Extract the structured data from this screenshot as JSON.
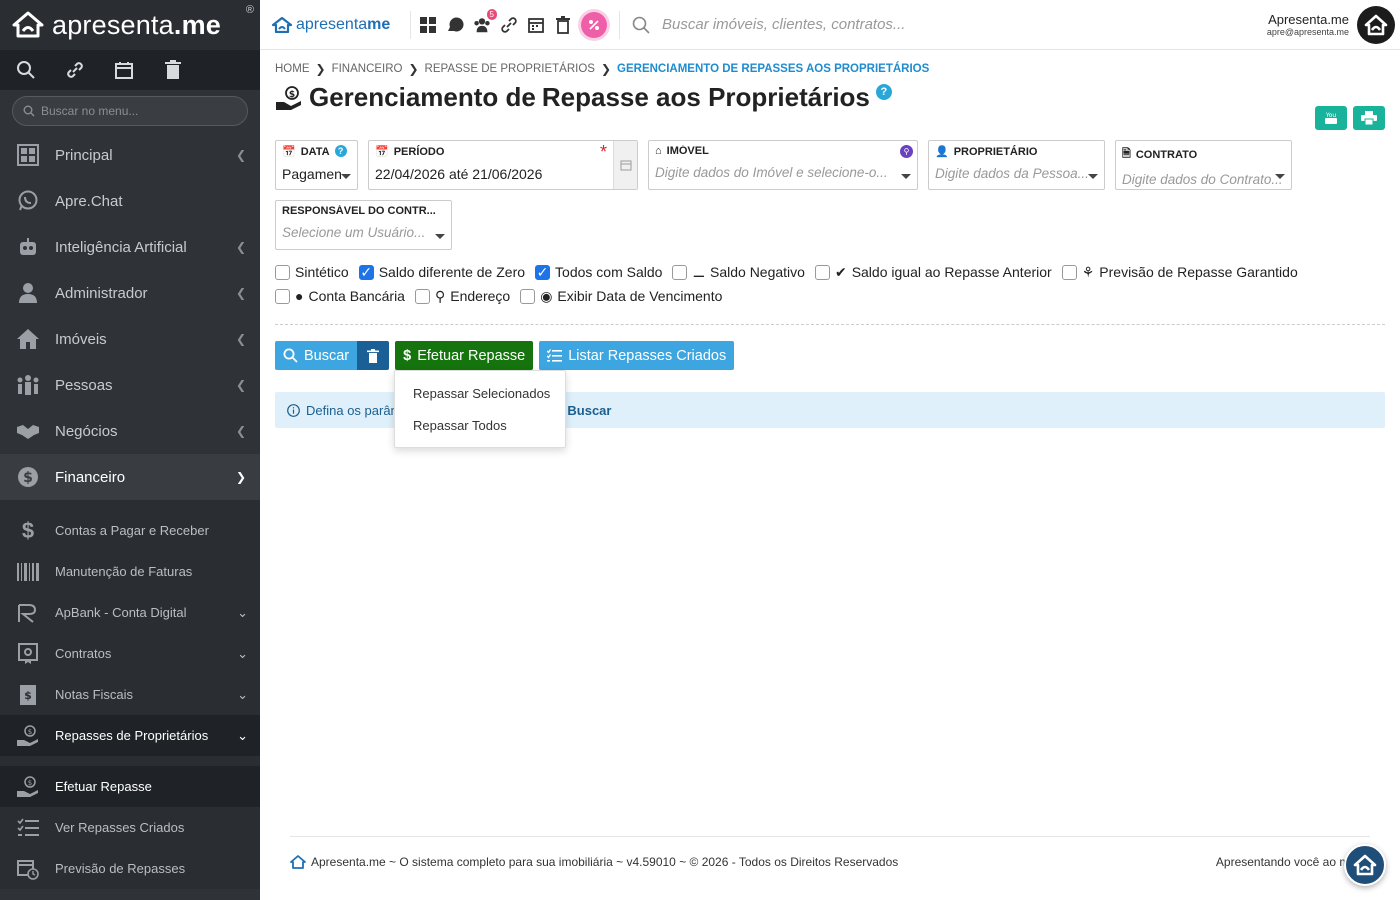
{
  "brand": {
    "name_pre": "apresenta",
    "name_post": ".me",
    "reg": "®"
  },
  "sidebar": {
    "search_placeholder": "Buscar no menu...",
    "items": [
      {
        "label": "Principal",
        "icon": "dashboard-icon"
      },
      {
        "label": "Apre.Chat",
        "icon": "whatsapp-icon"
      },
      {
        "label": "Inteligência Artificial",
        "icon": "robot-icon"
      },
      {
        "label": "Administrador",
        "icon": "user-tie-icon"
      },
      {
        "label": "Imóveis",
        "icon": "home-icon"
      },
      {
        "label": "Pessoas",
        "icon": "people-icon"
      },
      {
        "label": "Negócios",
        "icon": "handshake-icon"
      },
      {
        "label": "Financeiro",
        "icon": "dollar-circle-icon"
      }
    ],
    "finance_sub": [
      {
        "label": "Contas a Pagar e Receber"
      },
      {
        "label": "Manutenção de Faturas"
      },
      {
        "label": "ApBank - Conta Digital"
      },
      {
        "label": "Contratos"
      },
      {
        "label": "Notas Fiscais"
      },
      {
        "label": "Repasses de Proprietários"
      }
    ],
    "repasse_sub": [
      {
        "label": "Efetuar Repasse"
      },
      {
        "label": "Ver Repasses Criados"
      },
      {
        "label": "Previsão de Repasses"
      }
    ]
  },
  "topbar": {
    "brand_pre": "apresenta",
    "brand_post": "me",
    "badge": "5",
    "search_placeholder": "Buscar imóveis, clientes, contratos...",
    "user_name": "Apresenta.me",
    "user_email": "apre@apresenta.me"
  },
  "breadcrumb": [
    "HOME",
    "FINANCEIRO",
    "REPASSE DE PROPRIETÁRIOS",
    "GERENCIAMENTO DE REPASSES AOS PROPRIETÁRIOS"
  ],
  "page": {
    "title_pre": "Gerenciamento de",
    "title_bold": "Repasse aos Proprietários",
    "help": "?"
  },
  "filters": {
    "data": {
      "label": "DATA",
      "value": "Pagamen"
    },
    "periodo": {
      "label": "PERÍODO",
      "value": "22/04/2026 até 21/06/2026",
      "required": "*"
    },
    "imovel": {
      "label": "IMÓVEL",
      "placeholder": "Digite dados do Imóvel e selecione-o..."
    },
    "proprietario": {
      "label": "PROPRIETÁRIO",
      "placeholder": "Digite dados da Pessoa..."
    },
    "contrato": {
      "label": "CONTRATO",
      "placeholder": "Digite dados do Contrato..."
    },
    "responsavel": {
      "label": "RESPONSÁVEL DO CONTR...",
      "placeholder": "Selecione um Usuário..."
    }
  },
  "checks": [
    {
      "label": "Sintético",
      "checked": false
    },
    {
      "label": "Saldo diferente de Zero",
      "checked": true
    },
    {
      "label": "Todos com Saldo",
      "checked": true
    },
    {
      "label": "Saldo Negativo",
      "checked": false,
      "icon": "minus-circle-icon"
    },
    {
      "label": "Saldo igual ao Repasse Anterior",
      "checked": false,
      "icon": "check-circle-icon"
    },
    {
      "label": "Previsão de Repasse Garantido",
      "checked": false,
      "icon": "award-icon"
    },
    {
      "label": "Conta Bancária",
      "checked": false,
      "icon": "piggy-bank-icon"
    },
    {
      "label": "Endereço",
      "checked": false,
      "icon": "map-marker-icon"
    },
    {
      "label": "Exibir Data de Vencimento",
      "checked": false,
      "icon": "eye-icon"
    }
  ],
  "actions": {
    "buscar": "Buscar",
    "efetuar": "Efetuar Repasse",
    "listar": "Listar Repasses Criados"
  },
  "dropdown": [
    "Repassar Selecionados",
    "Repassar Todos"
  ],
  "info": {
    "text_pre": "Defina os parâm",
    "text_bold": "Buscar"
  },
  "footer": {
    "left": "Apresenta.me ~ O sistema completo para sua imobiliária ~ v4.59010 ~ © 2026 - Todos os Direitos Reservados",
    "right": "Apresentando você ao mu"
  }
}
